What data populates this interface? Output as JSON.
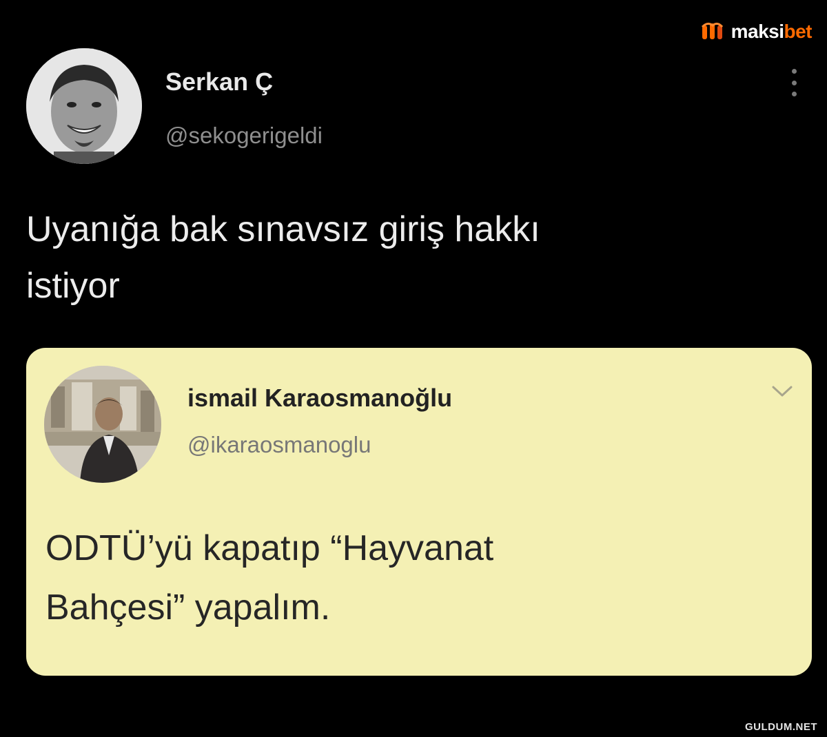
{
  "watermark": {
    "brand_prefix": "maksi",
    "brand_suffix": "bet",
    "brand_color": "#ff6a00",
    "site": "GULDUM.NET"
  },
  "tweet": {
    "author_name": "Serkan Ç",
    "author_handle": "@sekogerigeldi",
    "text_line1": "Uyanığa bak sınavsız giriş hakkı",
    "text_line2": "istiyor",
    "menu_icon": "more-vertical-icon"
  },
  "quoted_tweet": {
    "author_name": "ismail Karaosmanoğlu",
    "author_handle": "@ikaraosmanoglu",
    "text_line1": "ODTÜ’yü kapatıp “Hayvanat",
    "text_line2": "Bahçesi” yapalım.",
    "background_color": "#f4f0b4",
    "menu_icon": "chevron-down-icon"
  }
}
